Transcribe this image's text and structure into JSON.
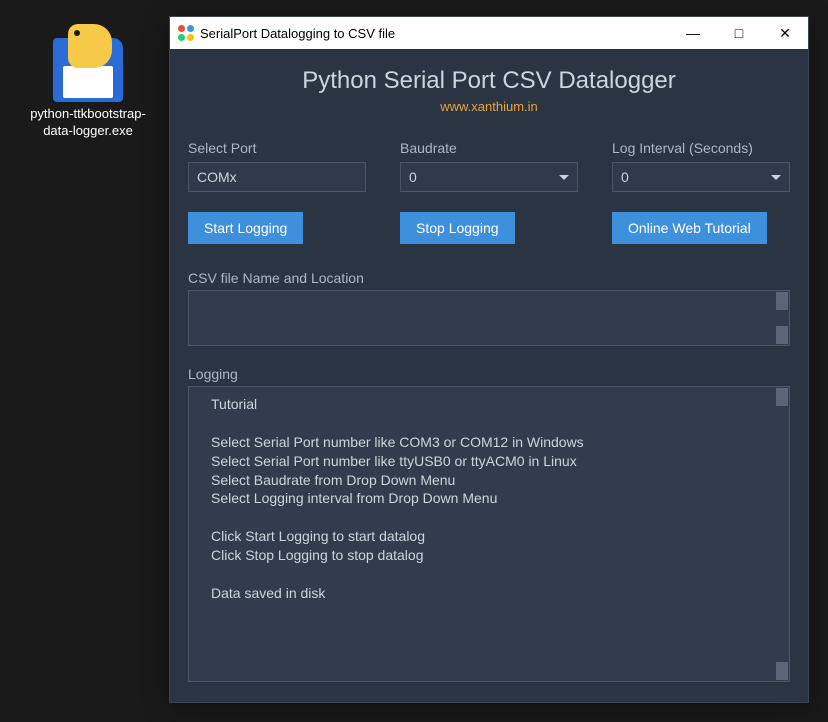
{
  "desktop": {
    "icon_label": "python-ttkbootstrap-data-logger.exe"
  },
  "window": {
    "title": "SerialPort Datalogging to CSV file"
  },
  "app": {
    "heading": "Python Serial Port CSV Datalogger",
    "link": "www.xanthium.in"
  },
  "form": {
    "port_label": "Select Port",
    "port_value": "COMx",
    "baud_label": "Baudrate",
    "baud_value": "0",
    "interval_label": "Log Interval (Seconds)",
    "interval_value": "0"
  },
  "buttons": {
    "start": "Start Logging",
    "stop": "Stop Logging",
    "tutorial": "Online Web Tutorial"
  },
  "csv": {
    "label": "CSV file Name and Location",
    "value": ""
  },
  "logging": {
    "label": "Logging",
    "content": "Tutorial\n\n   Select Serial Port number like COM3 or COM12 in Windows\n   Select Serial Port number like ttyUSB0 or ttyACM0 in Linux\n   Select Baudrate from Drop Down Menu\n   Select Logging interval from Drop Down Menu\n\n   Click Start Logging to start datalog\n   Click Stop  Logging to stop datalog\n\n   Data saved in disk"
  }
}
